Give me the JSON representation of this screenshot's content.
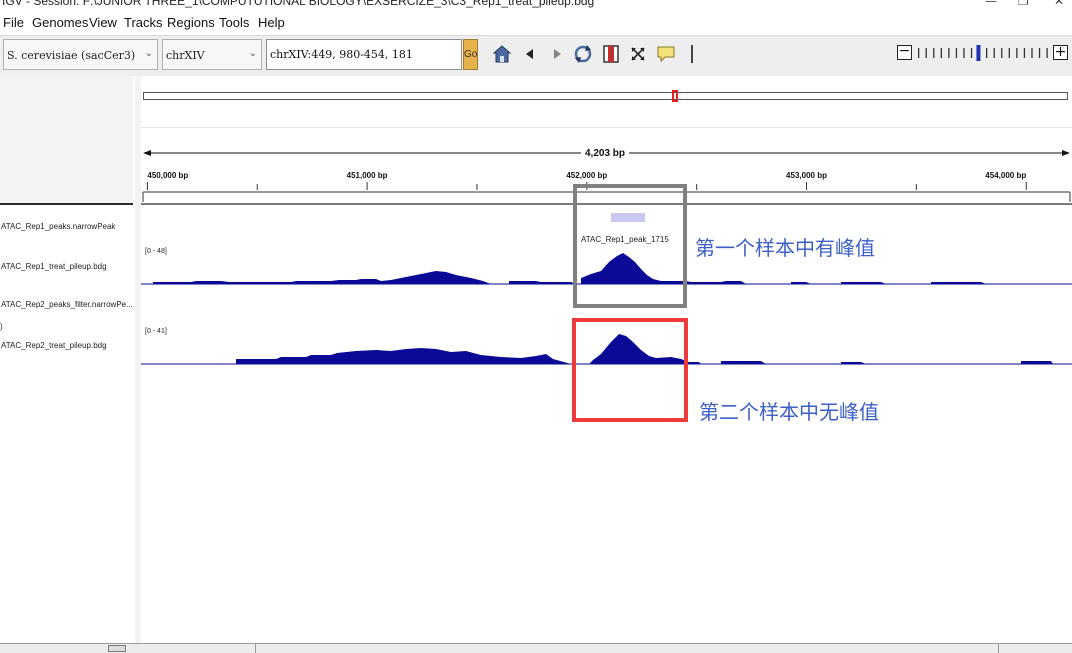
{
  "window": {
    "title": "IGV - Session: F:\\JUNIOR THREE_1\\COMPUTUTIONAL BIOLOGY\\EXSERCIZE_3\\C3_Rep1_treat_pileup.bdg",
    "minimize_glyph": "—",
    "restore_glyph": "❐",
    "close_glyph": "✕"
  },
  "menu": {
    "file": "File",
    "genomes": "Genomes",
    "view": "View",
    "tracks": "Tracks",
    "regions": "Regions",
    "tools": "Tools",
    "help": "Help"
  },
  "toolbar": {
    "genome": "S. cerevisiae (sacCer3)",
    "chromosome": "chrXIV",
    "locus": "chrXIV:449, 980-454, 181",
    "go_label": "Go",
    "zoom_out_glyph": "−",
    "zoom_in_glyph": "+",
    "zoom_level_fraction": 0.47,
    "icons": [
      "home-icon",
      "back-arrow-icon",
      "forward-arrow-icon",
      "refresh-icon",
      "region-of-interest-icon",
      "fit-window-icon",
      "popup-info-icon"
    ]
  },
  "ruler": {
    "span_label": "4,203 bp",
    "tick_labels": [
      "450,000 bp",
      "451,000 bp",
      "452,000 bp",
      "453,000 bp",
      "454,000 bp"
    ],
    "tick_positions_bp": [
      450000,
      451000,
      452000,
      453000,
      454000
    ],
    "view_start_bp": 449980,
    "view_end_bp": 454181
  },
  "tracks": [
    {
      "name": "ATAC_Rep1_peaks.narrowPeak"
    },
    {
      "name": "ATAC_Rep1_treat_pileup.bdg",
      "range": "[0 - 48]"
    },
    {
      "name": "ATAC_Rep2_peaks_filter.narrowPe..."
    },
    {
      "name": "ATAC_Rep2_treat_pileup.bdg",
      "range": "[0 - 41]"
    }
  ],
  "peak": {
    "label": "ATAC_Rep1_peak_1715",
    "color": "#c8c8f0"
  },
  "annotations": {
    "rep1": "第一个样本中有峰值",
    "rep2": "第二个样本中无峰值"
  },
  "colors": {
    "signal": "#0a0a96",
    "annotation_text": "#3d5fc7",
    "box_rep1": "#808080",
    "box_rep2": "#ee3a3a",
    "chrom_marker": "#e02020"
  }
}
